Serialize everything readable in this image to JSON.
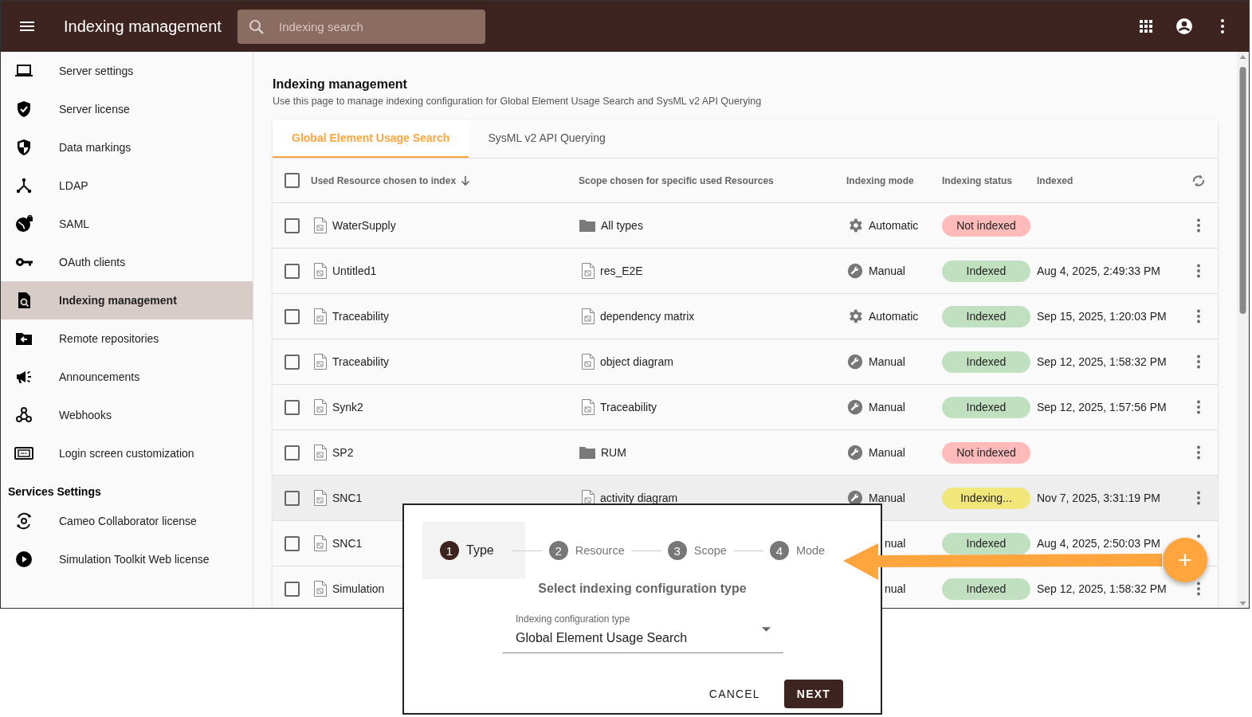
{
  "app_bar": {
    "title": "Indexing management",
    "search": {
      "placeholder": "Indexing search"
    }
  },
  "sidebar": {
    "items": [
      {
        "label": "Server settings",
        "selected": false
      },
      {
        "label": "Server license",
        "selected": false
      },
      {
        "label": "Data markings",
        "selected": false
      },
      {
        "label": "LDAP",
        "selected": false
      },
      {
        "label": "SAML",
        "selected": false
      },
      {
        "label": "OAuth clients",
        "selected": false
      },
      {
        "label": "Indexing management",
        "selected": true
      },
      {
        "label": "Remote repositories",
        "selected": false
      },
      {
        "label": "Announcements",
        "selected": false
      },
      {
        "label": "Webhooks",
        "selected": false
      },
      {
        "label": "Login screen customization",
        "selected": false
      }
    ],
    "section_title": "Services Settings",
    "section_items": [
      {
        "label": "Cameo Collaborator license",
        "selected": false
      },
      {
        "label": "Simulation Toolkit Web license",
        "selected": false
      }
    ]
  },
  "page": {
    "title": "Indexing management",
    "subtitle": "Use this page to manage indexing configuration for Global Element Usage Search and SysML v2 API Querying"
  },
  "tabs": [
    {
      "label": "Global Element Usage Search",
      "selected": true
    },
    {
      "label": "SysML v2 API Querying",
      "selected": false
    }
  ],
  "table": {
    "select_all": {
      "checked": false
    },
    "columns": [
      "Used Resource chosen to index",
      "Scope chosen for specific used Resources",
      "Indexing mode",
      "Indexing status",
      "Indexed"
    ],
    "rows": [
      {
        "checked": false,
        "hovered": false,
        "resource": "WaterSupply",
        "scope": {
          "text": "All types",
          "kind": "folder"
        },
        "mode": {
          "text": "Automatic",
          "kind": "automatic"
        },
        "status": {
          "text": "Not indexed",
          "kind": "not_indexed"
        }
      },
      {
        "checked": false,
        "hovered": false,
        "resource": "Untitled1",
        "scope": {
          "text": "res_E2E",
          "kind": "document"
        },
        "mode": {
          "text": "Manual",
          "kind": "manual"
        },
        "status": {
          "text": "Indexed",
          "kind": "indexed"
        },
        "indexed": "Aug 4, 2025, 2:49:33 PM"
      },
      {
        "checked": false,
        "hovered": false,
        "resource": "Traceability",
        "scope": {
          "text": "dependency matrix",
          "kind": "document"
        },
        "mode": {
          "text": "Automatic",
          "kind": "automatic"
        },
        "status": {
          "text": "Indexed",
          "kind": "indexed"
        },
        "indexed": "Sep 15, 2025, 1:20:03 PM"
      },
      {
        "checked": false,
        "hovered": false,
        "resource": "Traceability",
        "scope": {
          "text": "object diagram",
          "kind": "document"
        },
        "mode": {
          "text": "Manual",
          "kind": "manual"
        },
        "status": {
          "text": "Indexed",
          "kind": "indexed"
        },
        "indexed": "Sep 12, 2025, 1:58:32 PM"
      },
      {
        "checked": false,
        "hovered": false,
        "resource": "Synk2",
        "scope": {
          "text": "Traceability",
          "kind": "document"
        },
        "mode": {
          "text": "Manual",
          "kind": "manual"
        },
        "status": {
          "text": "Indexed",
          "kind": "indexed"
        },
        "indexed": "Sep 12, 2025, 1:57:56 PM"
      },
      {
        "checked": false,
        "hovered": false,
        "resource": "SP2",
        "scope": {
          "text": "RUM",
          "kind": "folder"
        },
        "mode": {
          "text": "Manual",
          "kind": "manual"
        },
        "status": {
          "text": "Not indexed",
          "kind": "not_indexed"
        }
      },
      {
        "checked": false,
        "hovered": true,
        "resource": "SNC1",
        "scope": {
          "text": "activity diagram",
          "kind": "document"
        },
        "mode": {
          "text": "Manual",
          "kind": "manual"
        },
        "status": {
          "text": "Indexing...",
          "kind": "indexing"
        },
        "indexed": "Nov 7, 2025, 3:31:19 PM"
      },
      {
        "checked": false,
        "hovered": false,
        "resource": "SNC1",
        "mode": {
          "text": "nual"
        },
        "status": {
          "text": "Indexed",
          "kind": "indexed"
        },
        "indexed": "Aug 4, 2025, 2:50:03 PM"
      },
      {
        "checked": false,
        "hovered": false,
        "resource": "Simulation",
        "mode": {
          "text": "nual"
        },
        "status": {
          "text": "Indexed",
          "kind": "indexed"
        },
        "indexed": "Sep 12, 2025, 1:58:32 PM"
      }
    ]
  },
  "dialog": {
    "steps": [
      {
        "number": "1",
        "label": "Type",
        "selected": true
      },
      {
        "number": "2",
        "label": "Resource",
        "selected": false
      },
      {
        "number": "3",
        "label": "Scope",
        "selected": false
      },
      {
        "number": "4",
        "label": "Mode",
        "selected": false
      }
    ],
    "heading": "Select indexing configuration type",
    "select": {
      "label": "Indexing configuration type",
      "value": "Global Element Usage Search"
    },
    "buttons": [
      {
        "label": "CANCEL",
        "kind": "text"
      },
      {
        "label": "NEXT",
        "kind": "primary"
      }
    ]
  },
  "fab": {
    "label": "+"
  }
}
